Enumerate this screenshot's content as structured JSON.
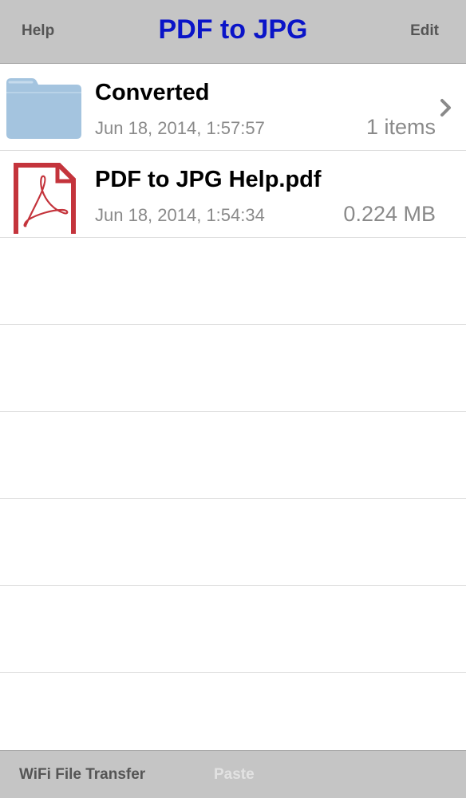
{
  "navbar": {
    "left_label": "Help",
    "title": "PDF to JPG",
    "right_label": "Edit",
    "title_color": "#0a14c8"
  },
  "files": [
    {
      "name": "Converted",
      "date": "Jun 18, 2014, 1:57:57",
      "meta": "1 items",
      "icon": "folder-icon",
      "has_chevron": true
    },
    {
      "name": "PDF to JPG Help.pdf",
      "date": "Jun 18, 2014, 1:54:34",
      "meta": "0.224 MB",
      "icon": "pdf-icon",
      "has_chevron": false
    }
  ],
  "toolbar": {
    "wifi_label": "WiFi File Transfer",
    "paste_label": "Paste",
    "paste_enabled": false
  },
  "colors": {
    "bar_background": "#c5c5c5",
    "folder_blue": "#a4c4df",
    "pdf_red": "#c4343c"
  }
}
